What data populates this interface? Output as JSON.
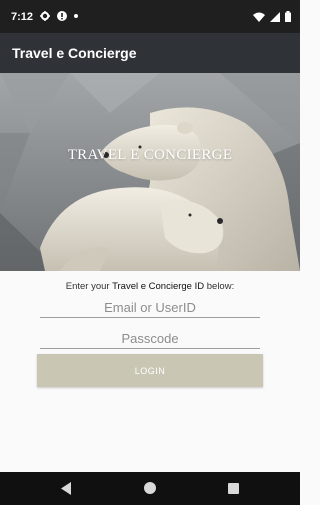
{
  "status_bar": {
    "time": "7:12",
    "icons_left": [
      "gear-icon",
      "alert-icon",
      "dot-icon"
    ],
    "icons_right": [
      "wifi-icon",
      "signal-icon",
      "battery-icon"
    ]
  },
  "app_bar": {
    "title": "Travel e Concierge"
  },
  "hero": {
    "brand_text": "TRAVEL E CONCIERGE",
    "image_subject": "two polar bears embracing"
  },
  "form": {
    "intro_prefix": "Enter your ",
    "intro_strong": "Travel e Concierge ID",
    "intro_suffix": " below:",
    "email_placeholder": "Email or UserID",
    "email_value": "",
    "passcode_placeholder": "Passcode",
    "passcode_value": "",
    "login_label": "LOGIN"
  },
  "nav_bar": {
    "icons": [
      "back-icon",
      "home-icon",
      "recents-icon"
    ]
  },
  "colors": {
    "status_bar": "#1f1f1f",
    "app_bar": "#2f3338",
    "login_button": "#c9c6b4",
    "background": "#fafafa"
  }
}
